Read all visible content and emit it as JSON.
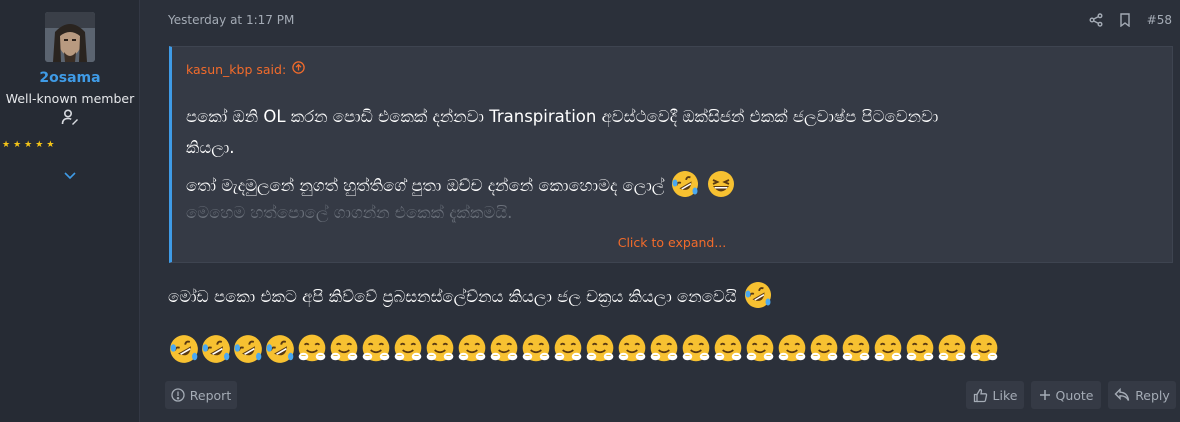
{
  "user": {
    "name": "2osama",
    "title": "Well-known member",
    "stars": 5
  },
  "post": {
    "date": "Yesterday at 1:17 PM",
    "number": "#58"
  },
  "quote": {
    "author_said": "kasun_kbp said:",
    "line1": "පකෝ ඔනි OL කරන පොඩි එකෙක් දන්නවා Transpiration අවස්ථවෙදී ඔක්සිජන් එකක් ජලවාෂ්ප පිටවෙනවා",
    "line2": "කියලා.",
    "line3": "තෝ මැදමුලනේ නුගත් හුත්තිගේ පුතා ඔච්ච දන්නේ කොහොමද ලොල්",
    "line4": "මෙහෙම හත්පොලේ ගාගන්න එකෙක් දැක්කමයි.",
    "expand": "Click to expand..."
  },
  "body": {
    "line1": "මෝඩ පකො එකට අපි කිව්වේ ප්‍රබසනස්ලේච්නය කියලා ජල චක්‍රය කියලා නෙවෙයි",
    "emojis": [
      "rofl",
      "rofl",
      "rofl",
      "rofl",
      "hug",
      "hug",
      "hug",
      "hug",
      "hug",
      "hug",
      "hug",
      "hug",
      "hug",
      "hug",
      "hug",
      "hug",
      "hug",
      "hug",
      "hug",
      "hug",
      "hug",
      "hug",
      "hug",
      "hug",
      "hug",
      "hug"
    ]
  },
  "actions": {
    "report": "Report",
    "like": "Like",
    "quote": "Quote",
    "reply": "Reply"
  },
  "colors": {
    "accent": "#3f9be6",
    "link": "#f26b2b",
    "star": "#f5c518"
  }
}
